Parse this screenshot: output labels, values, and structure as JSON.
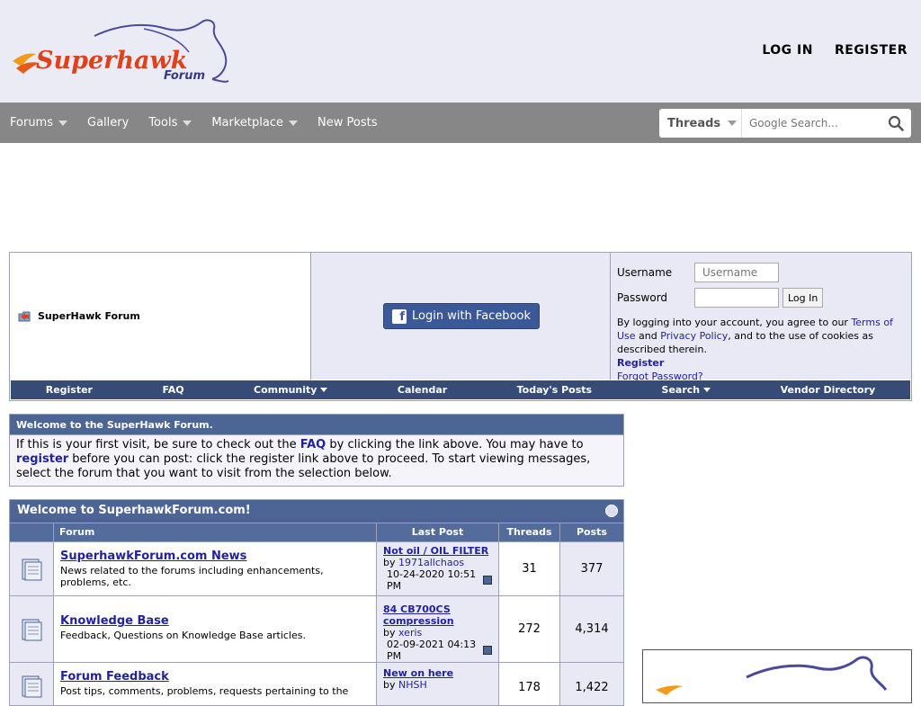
{
  "header": {
    "login_label": "LOG IN",
    "register_label": "REGISTER"
  },
  "nav": {
    "items": [
      {
        "label": "Forums",
        "dropdown": true
      },
      {
        "label": "Gallery",
        "dropdown": false
      },
      {
        "label": "Tools",
        "dropdown": true
      },
      {
        "label": "Marketplace",
        "dropdown": true
      },
      {
        "label": "New Posts",
        "dropdown": false
      }
    ],
    "search": {
      "type_label": "Threads",
      "placeholder": "Google Search..."
    }
  },
  "loginblock": {
    "breadcrumb": "SuperHawk Forum",
    "facebook_label": "Login with Facebook",
    "username_label": "Username",
    "username_placeholder": "Username",
    "password_label": "Password",
    "login_button": "Log In",
    "terms_prefix": "By logging into your account, you agree to our ",
    "terms_link": "Terms of Use",
    "terms_mid": " and ",
    "privacy_link": "Privacy Policy",
    "terms_suffix": ", and to the use of cookies as described therein.",
    "register_link": "Register",
    "forgot_link": "Forgot Password?"
  },
  "sublinks": {
    "register": "Register",
    "faq": "FAQ",
    "community": "Community",
    "calendar": "Calendar",
    "todays_posts": "Today's Posts",
    "search": "Search",
    "vendor": "Vendor Directory"
  },
  "welcome": {
    "title": "Welcome to the SuperHawk Forum.",
    "text_1": "If this is your first visit, be sure to check out the ",
    "faq_link": "FAQ",
    "text_2": " by clicking the link above. You may have to ",
    "register_link": "register",
    "text_3": " before you can post: click the register link above to proceed. To start viewing messages, select the forum that you want to visit from the selection below."
  },
  "forums": {
    "title": "Welcome to SuperhawkForum.com!",
    "col_forum": "Forum",
    "col_last": "Last Post",
    "col_threads": "Threads",
    "col_posts": "Posts",
    "rows": [
      {
        "name": "SuperhawkForum.com News",
        "desc": "News related to the forums including enhancements, problems, etc.",
        "last_title": "Not oil / OIL FILTER",
        "by": "by ",
        "last_user": "1971allchaos",
        "last_date": "10-24-2020",
        "last_time": "10:51 PM",
        "threads": "31",
        "posts": "377"
      },
      {
        "name": "Knowledge Base",
        "desc": "Feedback, Questions on Knowledge Base articles.",
        "last_title": "84 CB700CS compression",
        "by": "by ",
        "last_user": "xeris",
        "last_date": "02-09-2021",
        "last_time": "04:13 PM",
        "threads": "272",
        "posts": "4,314"
      },
      {
        "name": "Forum Feedback",
        "desc": "Post tips, comments, problems, requests pertaining to the",
        "last_title": "New on here",
        "by": "by ",
        "last_user": "NHSH",
        "last_date": "",
        "last_time": "",
        "threads": "178",
        "posts": "1,422"
      }
    ]
  },
  "colors": {
    "header_bg": "#ebebf5",
    "nav_bg": "#878787",
    "table_head": "#4d6595",
    "link": "#22229c",
    "facebook": "#3b5998"
  }
}
